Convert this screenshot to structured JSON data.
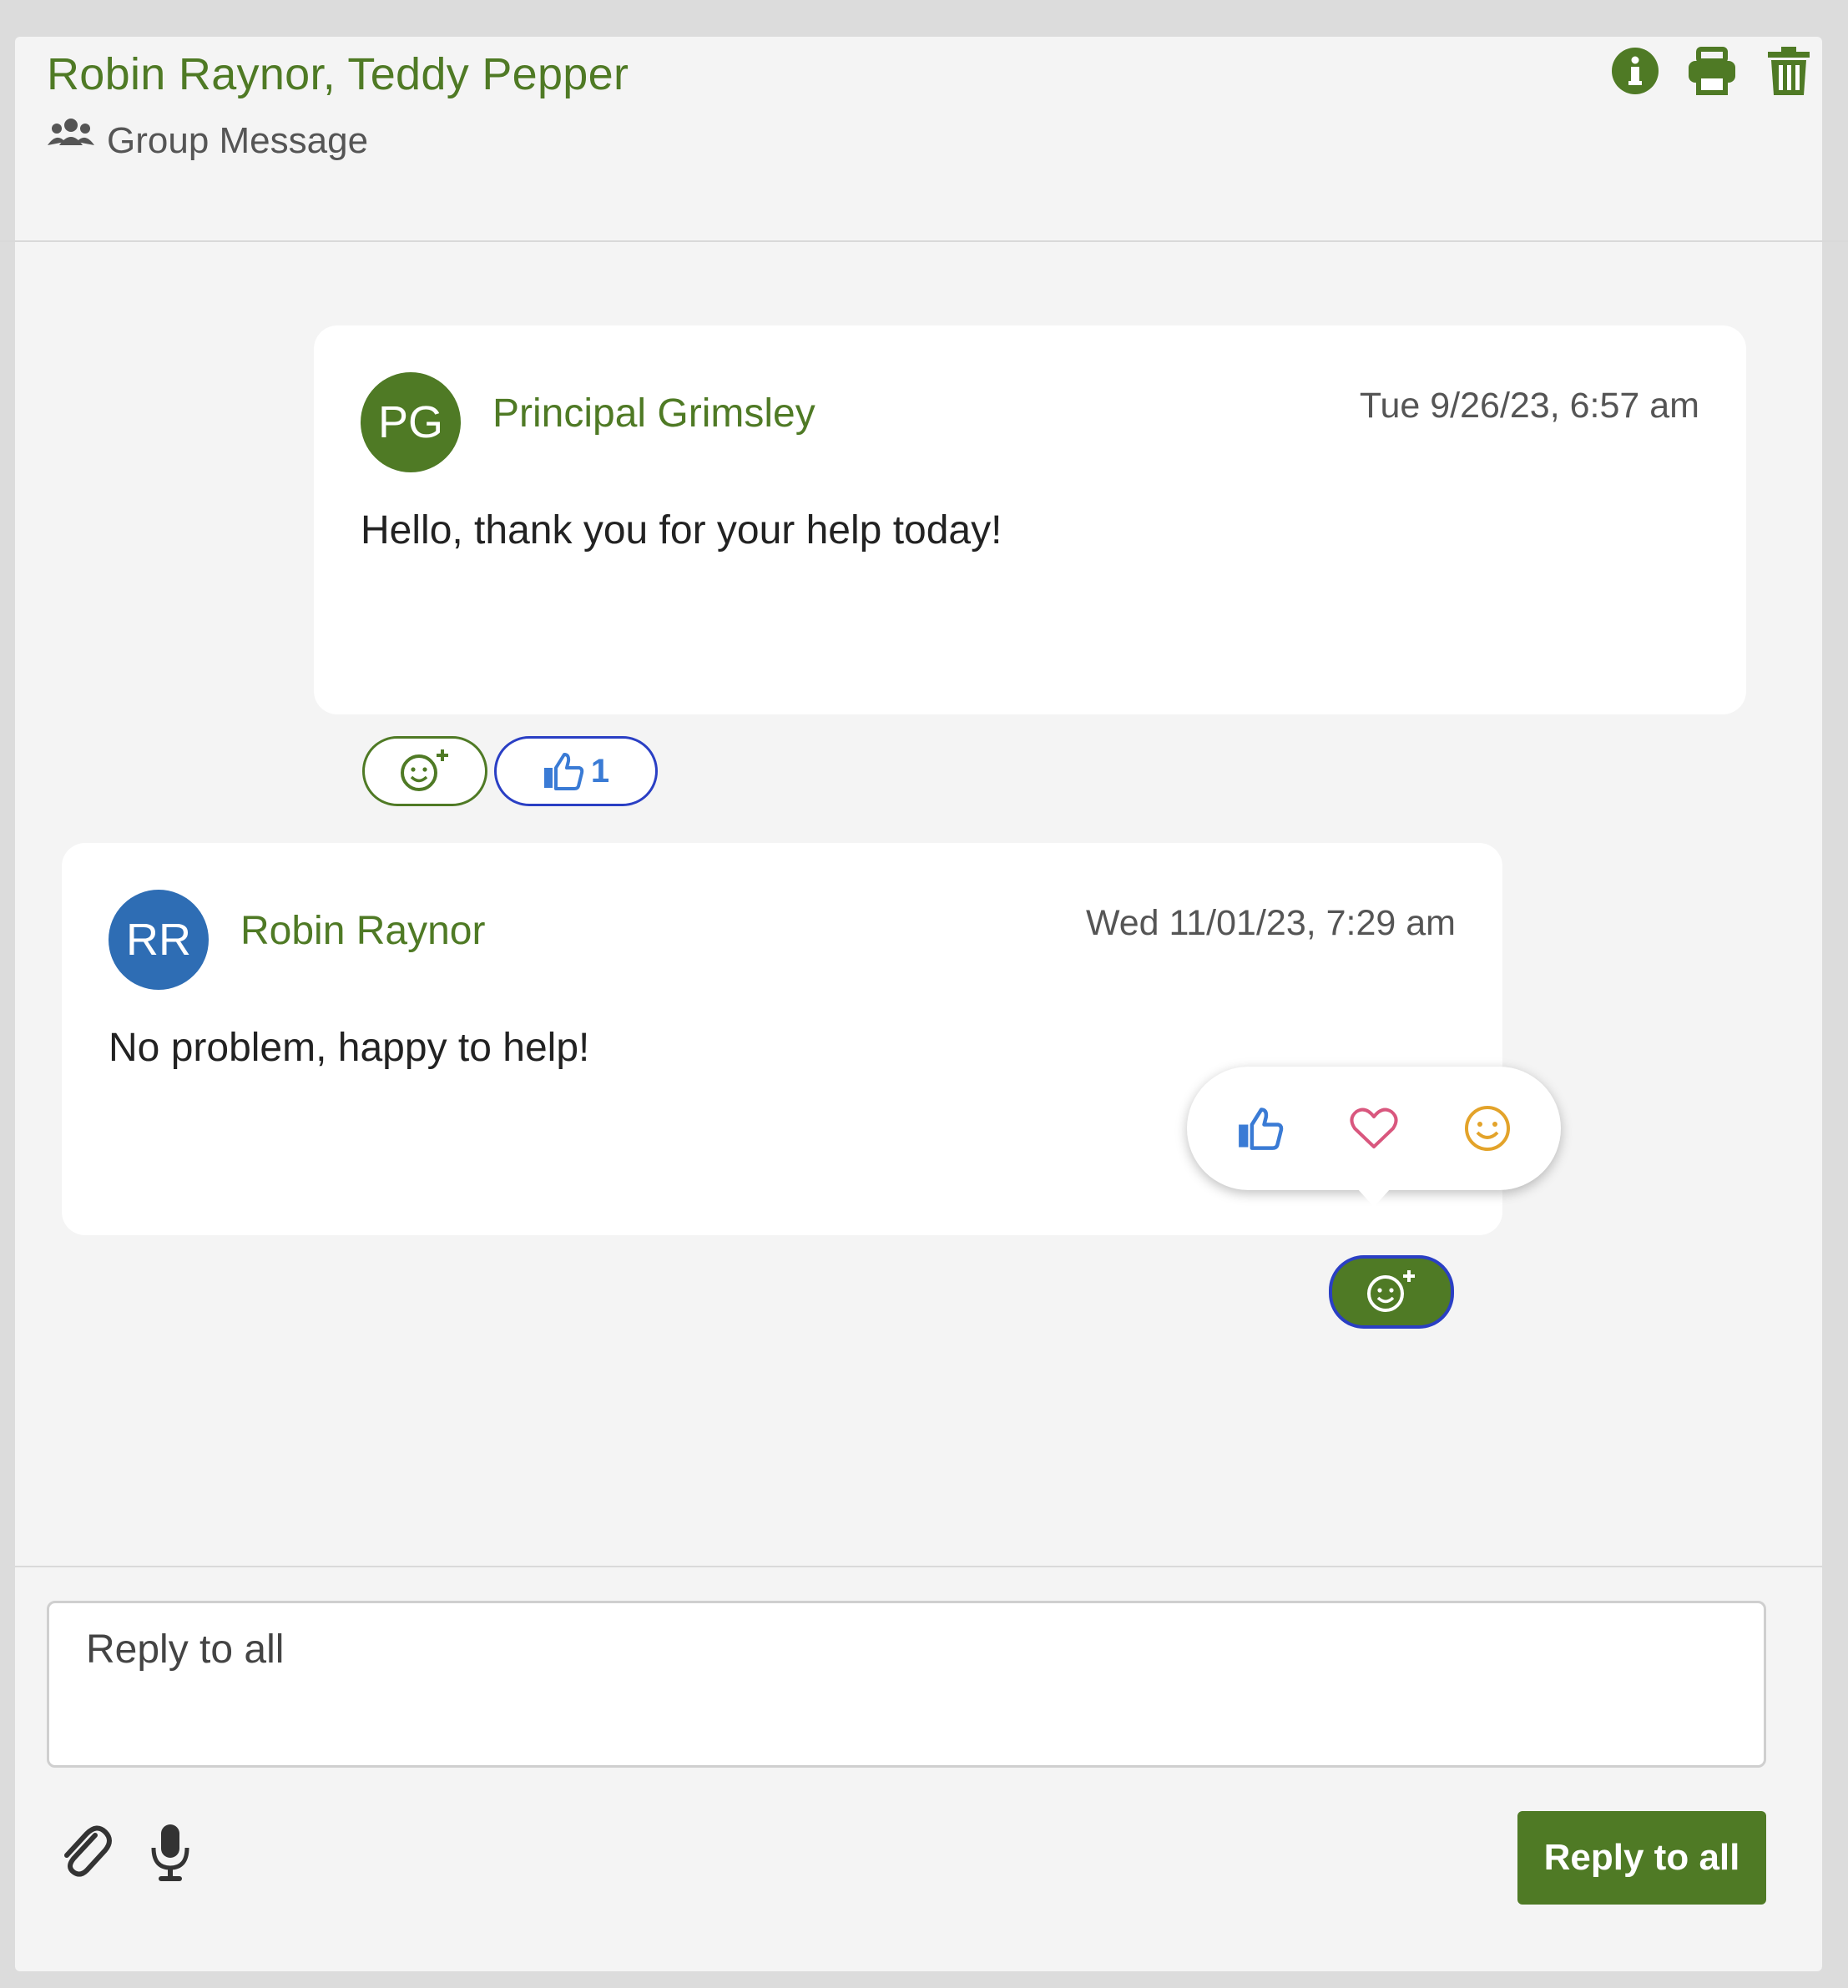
{
  "thread": {
    "title": "Robin Raynor, Teddy Pepper",
    "subtitle": "Group Message",
    "actions": [
      {
        "icon": "info-icon"
      },
      {
        "icon": "print-icon"
      },
      {
        "icon": "trash-icon"
      }
    ]
  },
  "messages": [
    {
      "initials": "PG",
      "sender": "Principal Grimsley",
      "timestamp": "Tue 9/26/23, 6:57 am",
      "body": "Hello, thank you for your help today!",
      "avatar_color": "#4f7a25",
      "reactions": [
        {
          "icon": "thumbs-up-icon",
          "count": "1"
        }
      ]
    },
    {
      "initials": "RR",
      "sender": "Robin Raynor",
      "timestamp": "Wed 11/01/23, 7:29 am",
      "body": "No problem, happy to help!",
      "avatar_color": "#2e6db4",
      "reactions": []
    }
  ],
  "reaction_picker": {
    "options": [
      "thumbs-up-icon",
      "heart-icon",
      "smile-icon"
    ]
  },
  "composer": {
    "placeholder": "Reply to all",
    "send_label": "Reply to all"
  },
  "colors": {
    "brand_green": "#4f7a25",
    "like_blue": "#3a7bd5",
    "heart_pink": "#d9577e",
    "smile_gold": "#e3a32a"
  }
}
